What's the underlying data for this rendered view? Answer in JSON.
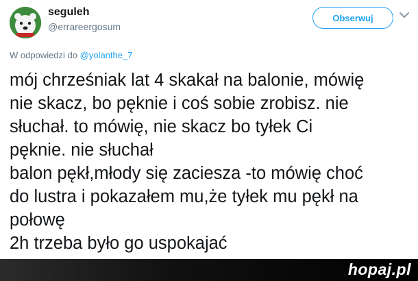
{
  "header": {
    "display_name": "seguleh",
    "handle": "@errareergosum",
    "follow_label": "Obserwuj",
    "avatar_icon": "polar-bear-icon",
    "menu_icon": "chevron-down-icon"
  },
  "reply": {
    "prefix": "W odpowiedzi do",
    "mention": "@yolanthe_7"
  },
  "tweet": {
    "lines": [
      "mój chrześniak lat 4 skakał na balonie, mówię",
      "nie skacz, bo pęknie i coś sobie zrobisz. nie",
      "słuchał. to mówię, nie skacz bo tyłek Ci",
      "pęknie. nie słuchał",
      "balon pękł,młody się zaciesza -to mówię choć",
      "do lustra i pokazałem mu,że tyłek mu pękł na",
      "połowę",
      "2h trzeba było go uspokajać"
    ]
  },
  "watermark": {
    "text": "hopaj.pl"
  },
  "colors": {
    "accent": "#1da1f2",
    "text": "#14171a",
    "muted": "#657786"
  }
}
